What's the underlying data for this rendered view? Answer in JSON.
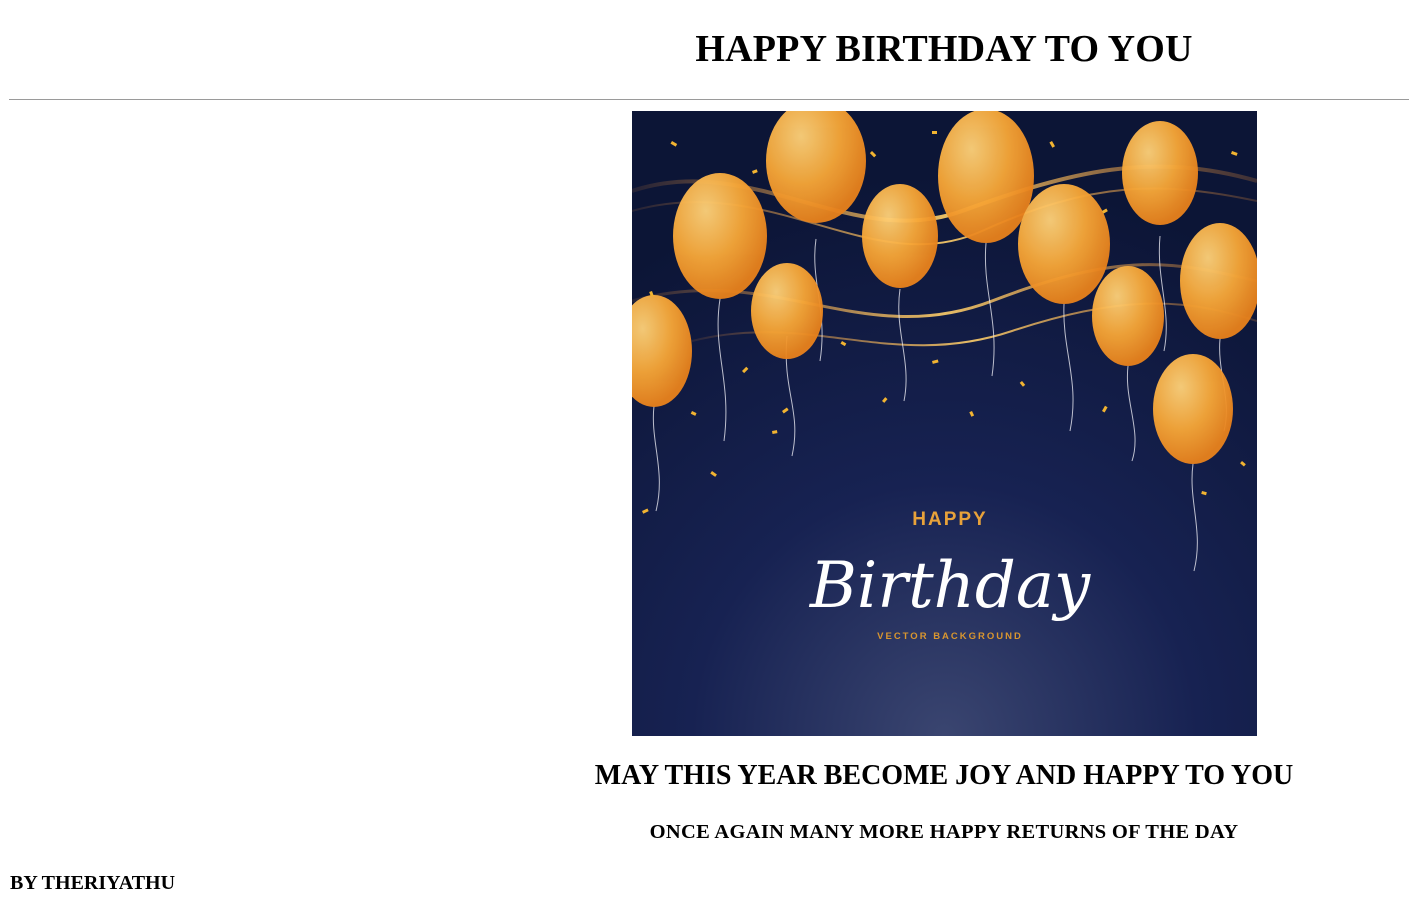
{
  "page": {
    "title": "HAPPY BIRTHDAY TO YOU",
    "message": "MAY THIS YEAR BECOME JOY AND HAPPY TO YOU",
    "submessage": "ONCE AGAIN MANY MORE HAPPY RETURNS OF THE DAY",
    "byline": "BY THERIYATHU"
  },
  "card_image": {
    "happy_text": "HAPPY",
    "script_text": "Birthday",
    "caption_text": "VECTOR BACKGROUND",
    "background_color": "#0f1a3f",
    "balloon_color": "#f5a623",
    "accent_color": "#e8a23a"
  }
}
